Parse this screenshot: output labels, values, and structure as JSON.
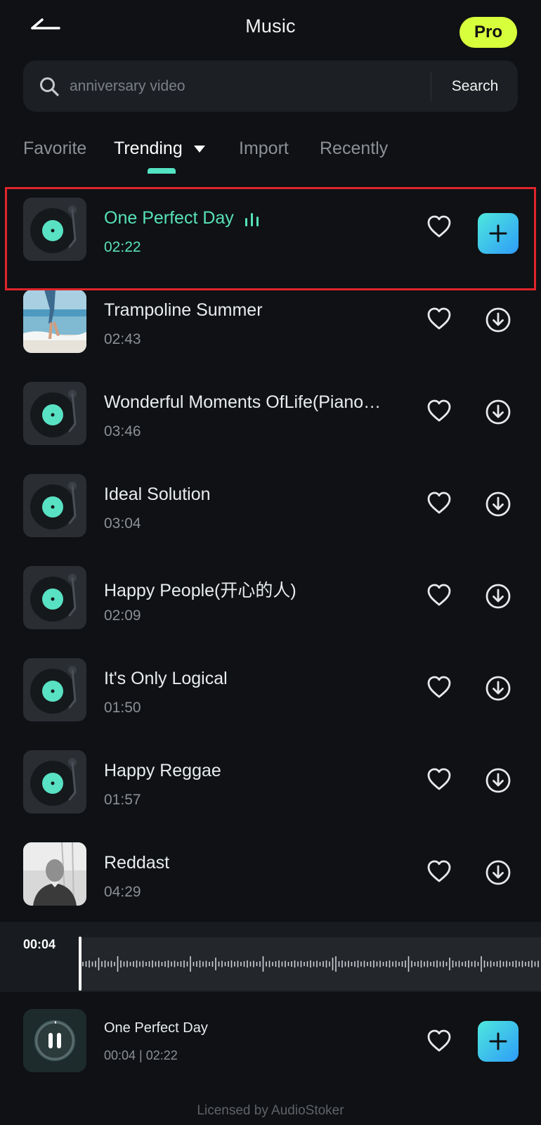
{
  "header": {
    "title": "Music",
    "pro_label": "Pro"
  },
  "search": {
    "placeholder": "anniversary video",
    "value": "",
    "button_label": "Search"
  },
  "tabs": [
    {
      "label": "Favorite",
      "active": false
    },
    {
      "label": "Trending",
      "active": true
    },
    {
      "label": "Import",
      "active": false
    },
    {
      "label": "Recently",
      "active": false
    }
  ],
  "tracks": [
    {
      "title": "One Perfect Day",
      "duration": "02:22",
      "thumb": "turntable-thumbnail",
      "playing": true,
      "action": "add-icon"
    },
    {
      "title": "Trampoline Summer",
      "duration": "02:43",
      "thumb": "beach-photo-thumbnail",
      "playing": false,
      "action": "download-icon"
    },
    {
      "title": "Wonderful Moments OfLife(Piano…",
      "duration": "03:46",
      "thumb": "turntable-thumbnail",
      "playing": false,
      "action": "download-icon"
    },
    {
      "title": "Ideal Solution",
      "duration": "03:04",
      "thumb": "turntable-thumbnail",
      "playing": false,
      "action": "download-icon"
    },
    {
      "title": "Happy People(开心的人)",
      "duration": "02:09",
      "thumb": "turntable-thumbnail",
      "playing": false,
      "action": "download-icon"
    },
    {
      "title": "It's Only Logical",
      "duration": "01:50",
      "thumb": "turntable-thumbnail",
      "playing": false,
      "action": "download-icon"
    },
    {
      "title": "Happy Reggae",
      "duration": "01:57",
      "thumb": "turntable-thumbnail",
      "playing": false,
      "action": "download-icon"
    },
    {
      "title": "Reddast",
      "duration": "04:29",
      "thumb": "portrait-photo-thumbnail",
      "playing": false,
      "action": "download-icon"
    }
  ],
  "waveform": {
    "current_time": "00:04"
  },
  "player": {
    "title": "One Perfect Day",
    "time": "00:04 | 02:22",
    "progress": 0.03
  },
  "license": "Licensed by AudioStoker",
  "colors": {
    "accent": "#58e2b7",
    "pro_badge": "#d8ff3c",
    "add_gradient_start": "#4ee8dd",
    "add_gradient_end": "#2f9cf8",
    "highlight": "#e1242b"
  }
}
